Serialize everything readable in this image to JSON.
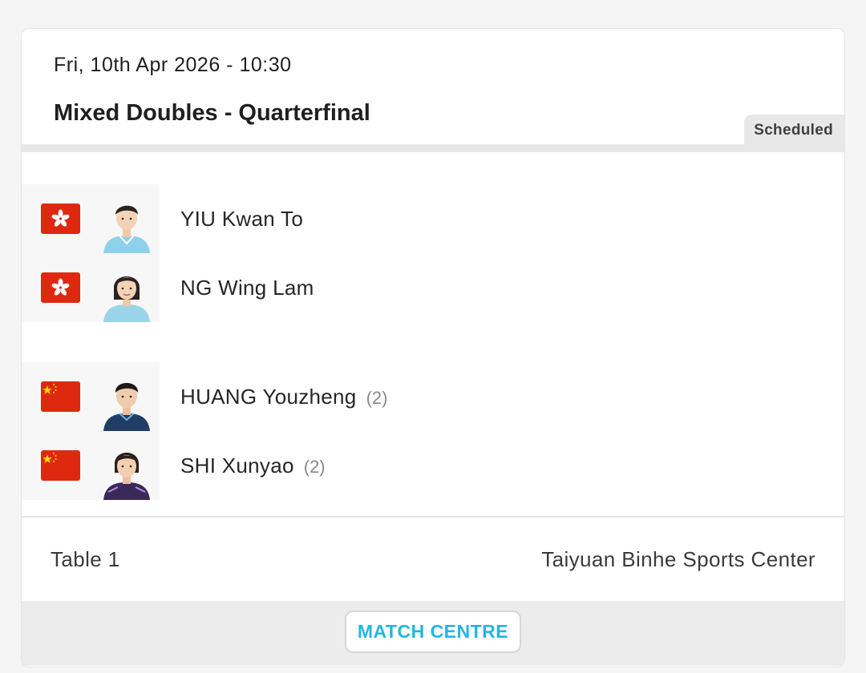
{
  "match": {
    "datetime": "Fri, 10th Apr 2026 - 10:30",
    "title": "Mixed Doubles - Quarterfinal",
    "status": "Scheduled"
  },
  "teams": [
    {
      "players": [
        {
          "name": "YIU Kwan To",
          "seed": "",
          "flag": "hong-kong-flag-icon"
        },
        {
          "name": "NG Wing Lam",
          "seed": "",
          "flag": "hong-kong-flag-icon"
        }
      ]
    },
    {
      "players": [
        {
          "name": "HUANG Youzheng",
          "seed": "(2)",
          "flag": "china-flag-icon"
        },
        {
          "name": "SHI Xunyao",
          "seed": "(2)",
          "flag": "china-flag-icon"
        }
      ]
    }
  ],
  "footer": {
    "table": "Table 1",
    "venue": "Taiyuan Binhe Sports Center"
  },
  "actions": {
    "match_centre_label": "MATCH CENTRE"
  },
  "colors": {
    "accent": "#22b5e6",
    "flag_red": "#de2910",
    "flag_star": "#ffde00",
    "badge_bg": "#e8e8e8"
  }
}
